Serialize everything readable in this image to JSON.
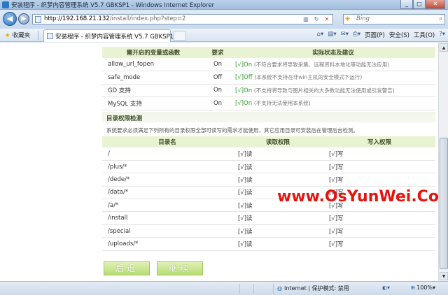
{
  "window": {
    "title": "安装程序 - 织梦内容管理系统 V5.7 GBKSP1 - Windows Internet Explorer",
    "minimize": "_",
    "maximize": "□",
    "close": "✕"
  },
  "address": {
    "url_host": "http://192.168.21.132",
    "url_path": "/install/index.php?step=2",
    "search_placeholder": "Bing"
  },
  "favbar": {
    "favorites_label": "收藏夹",
    "tab_label": "安装程序 - 织梦内容管理系统 V5.7 GBKSP1",
    "page_menu": "页面(P)",
    "safety_menu": "安全(S)",
    "tools_menu": "工具(O)"
  },
  "functions_table": {
    "headers": [
      "需开启的变量或函数",
      "要求",
      "实际状态及建议"
    ],
    "rows": [
      {
        "name": "allow_url_fopen",
        "req": "On",
        "status": "[√]On",
        "note": "(不符合要求将导致采集、远程资料本地化等功能无法应用)"
      },
      {
        "name": "safe_mode",
        "req": "Off",
        "status": "[√]Off",
        "note": "(本系统不支持在非win主机的安全模式下运行)"
      },
      {
        "name": "GD 支持",
        "req": "On",
        "status": "[√]On",
        "note": "(不支持将导致与图片相关的大多数功能无法使用或引发警告)"
      },
      {
        "name": "MySQL 支持",
        "req": "On",
        "status": "[√]On",
        "note": "(不支持无法使用本系统)"
      }
    ]
  },
  "dir_section": {
    "title": "目录权限检测",
    "description": "系统要求必须满足下列所有的目录权限全部可读写的需求才能使用，其它应用目录可安装后在管理后台检测。",
    "headers": [
      "目录名",
      "读取权限",
      "写入权限"
    ],
    "rows": [
      {
        "dir": "/",
        "read": "[√]读",
        "write": "[√]写"
      },
      {
        "dir": "/plus/*",
        "read": "[√]读",
        "write": "[√]写"
      },
      {
        "dir": "/dede/*",
        "read": "[√]读",
        "write": "[√]写"
      },
      {
        "dir": "/data/*",
        "read": "[√]读",
        "write": "[√]写"
      },
      {
        "dir": "/a/*",
        "read": "[√]读",
        "write": "[√]写"
      },
      {
        "dir": "/install",
        "read": "[√]读",
        "write": "[√]写"
      },
      {
        "dir": "/special",
        "read": "[√]读",
        "write": "[√]写"
      },
      {
        "dir": "/uploads/*",
        "read": "[√]读",
        "write": "[√]写"
      }
    ]
  },
  "buttons": {
    "back": "后退",
    "next": "继续"
  },
  "watermark": "www.OsYunWei.Com",
  "statusbar": {
    "zone": "Internet | 保护模式: 禁用",
    "zoom": "100%"
  },
  "colors": {
    "ok_green": "#2d9f2a",
    "header_bg": "#e8f3d3",
    "button_green": "#b7dc74",
    "watermark_red": "#e5140f"
  }
}
